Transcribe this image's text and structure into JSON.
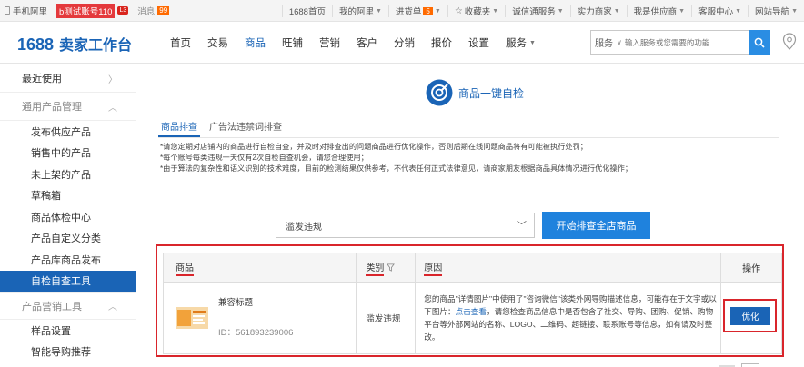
{
  "topbar": {
    "mobile": "手机阿里",
    "account": "b测试账号110",
    "level": "L3",
    "message": "消息",
    "message_count": "99",
    "right": [
      {
        "label": "1688首页",
        "caret": false
      },
      {
        "label": "我的阿里",
        "caret": true
      },
      {
        "label": "进货单",
        "badge": "5",
        "caret": true
      },
      {
        "label": "收藏夹",
        "star": true,
        "caret": true
      },
      {
        "label": "诚信通服务",
        "caret": true
      },
      {
        "label": "实力商家",
        "caret": true
      },
      {
        "label": "我是供应商",
        "caret": true
      },
      {
        "label": "客服中心",
        "caret": true
      },
      {
        "label": "网站导航",
        "caret": true
      }
    ]
  },
  "header": {
    "logo_num": "1688",
    "logo_text": "卖家工作台",
    "nav": [
      {
        "label": "首页",
        "active": false
      },
      {
        "label": "交易",
        "active": false
      },
      {
        "label": "商品",
        "active": true
      },
      {
        "label": "旺铺",
        "active": false
      },
      {
        "label": "营销",
        "active": false
      },
      {
        "label": "客户",
        "active": false
      },
      {
        "label": "分销",
        "active": false
      },
      {
        "label": "报价",
        "active": false
      },
      {
        "label": "设置",
        "active": false
      },
      {
        "label": "服务",
        "active": false,
        "caret": true
      }
    ],
    "search_scope": "服务",
    "search_placeholder": "输入服务或您需要的功能"
  },
  "sidebar": {
    "recent": "最近使用",
    "group1": "通用产品管理",
    "items": [
      "发布供应产品",
      "销售中的产品",
      "未上架的产品",
      "草稿箱",
      "商品体检中心",
      "产品自定义分类",
      "产品库商品发布",
      "自检自查工具"
    ],
    "active_index": 7,
    "group2": "产品营销工具",
    "items2": [
      "样品设置",
      "智能导购推荐"
    ]
  },
  "main": {
    "title": "商品一键自检",
    "tabs": [
      "商品排查",
      "广告法违禁词排查"
    ],
    "notes": [
      "*请您定期对店铺内的商品进行自检自查，并及时对排查出的问题商品进行优化操作，否则后期在线问题商品将有可能被执行处罚；",
      "*每个账号每类违规一天仅有2次自检自查机会，请您合理使用；",
      "*由于算法的复杂性和语义识别的技术难度，目前的检测结果仅供参考，不代表任何正式法律意见，请商家朋友根据商品具体情况进行优化操作；"
    ],
    "filter_value": "滥发违规",
    "scan_button": "开始排查全店商品",
    "table": {
      "headers": [
        "商品",
        "类别",
        "原因",
        "操作"
      ],
      "row": {
        "product_title": "兼容标题",
        "product_id": "ID：561893239006",
        "category": "滥发违规",
        "reason_before": "您的商品\"详情图片\"中使用了\"咨询微信\"该类外网导购描述信息，可能存在于文字或以下图片：",
        "reason_link": "点击查看",
        "reason_after": "，请您检查商品信息中是否包含了社交、导购、团购、促销、购物平台等外部网站的名称、LOGO、二维码、超链接、联系账号等信息，如有请及时整改。",
        "action": "优化"
      }
    }
  },
  "colors": {
    "brand": "#1a64b6",
    "highlight_frame": "#d9252b",
    "primary_button": "#1f82dd"
  }
}
